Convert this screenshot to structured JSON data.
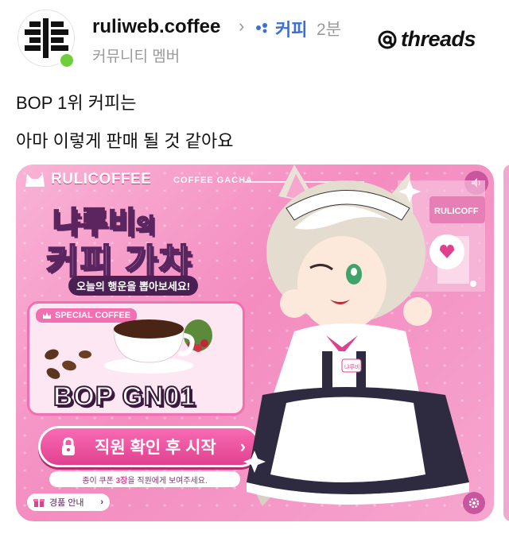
{
  "post": {
    "username": "ruliweb.coffee",
    "topic": "커피",
    "time": "2분",
    "subtitle": "커뮤니티 멤버",
    "brand": "threads",
    "text_line1": "BOP 1위 커피는",
    "text_line2": "아마 이렇게 판매 될 것 같아요"
  },
  "banner": {
    "brand": "RULICOFFEE",
    "brand_sub": "COFFEE GACHA",
    "title_line1": "냐루비",
    "title_line1_suffix": "의",
    "title_line2": "커피 가챠",
    "tagline": "오늘의 행운을 뽑아보세요!",
    "card_tag": "SPECIAL COFFEE",
    "product": "BOP GN01",
    "start_button": "직원 확인 후 시작",
    "note_prefix": "종이 쿠폰",
    "note_highlight": "3장",
    "note_suffix": "을 직원에게 보여주세요.",
    "prize_button": "경품 안내",
    "shop_sign": "RULICOFF",
    "name_tag": "냐루비"
  },
  "colors": {
    "accent": "#e0418f",
    "topic": "#3a6fd8",
    "online": "#6fcf3a"
  }
}
